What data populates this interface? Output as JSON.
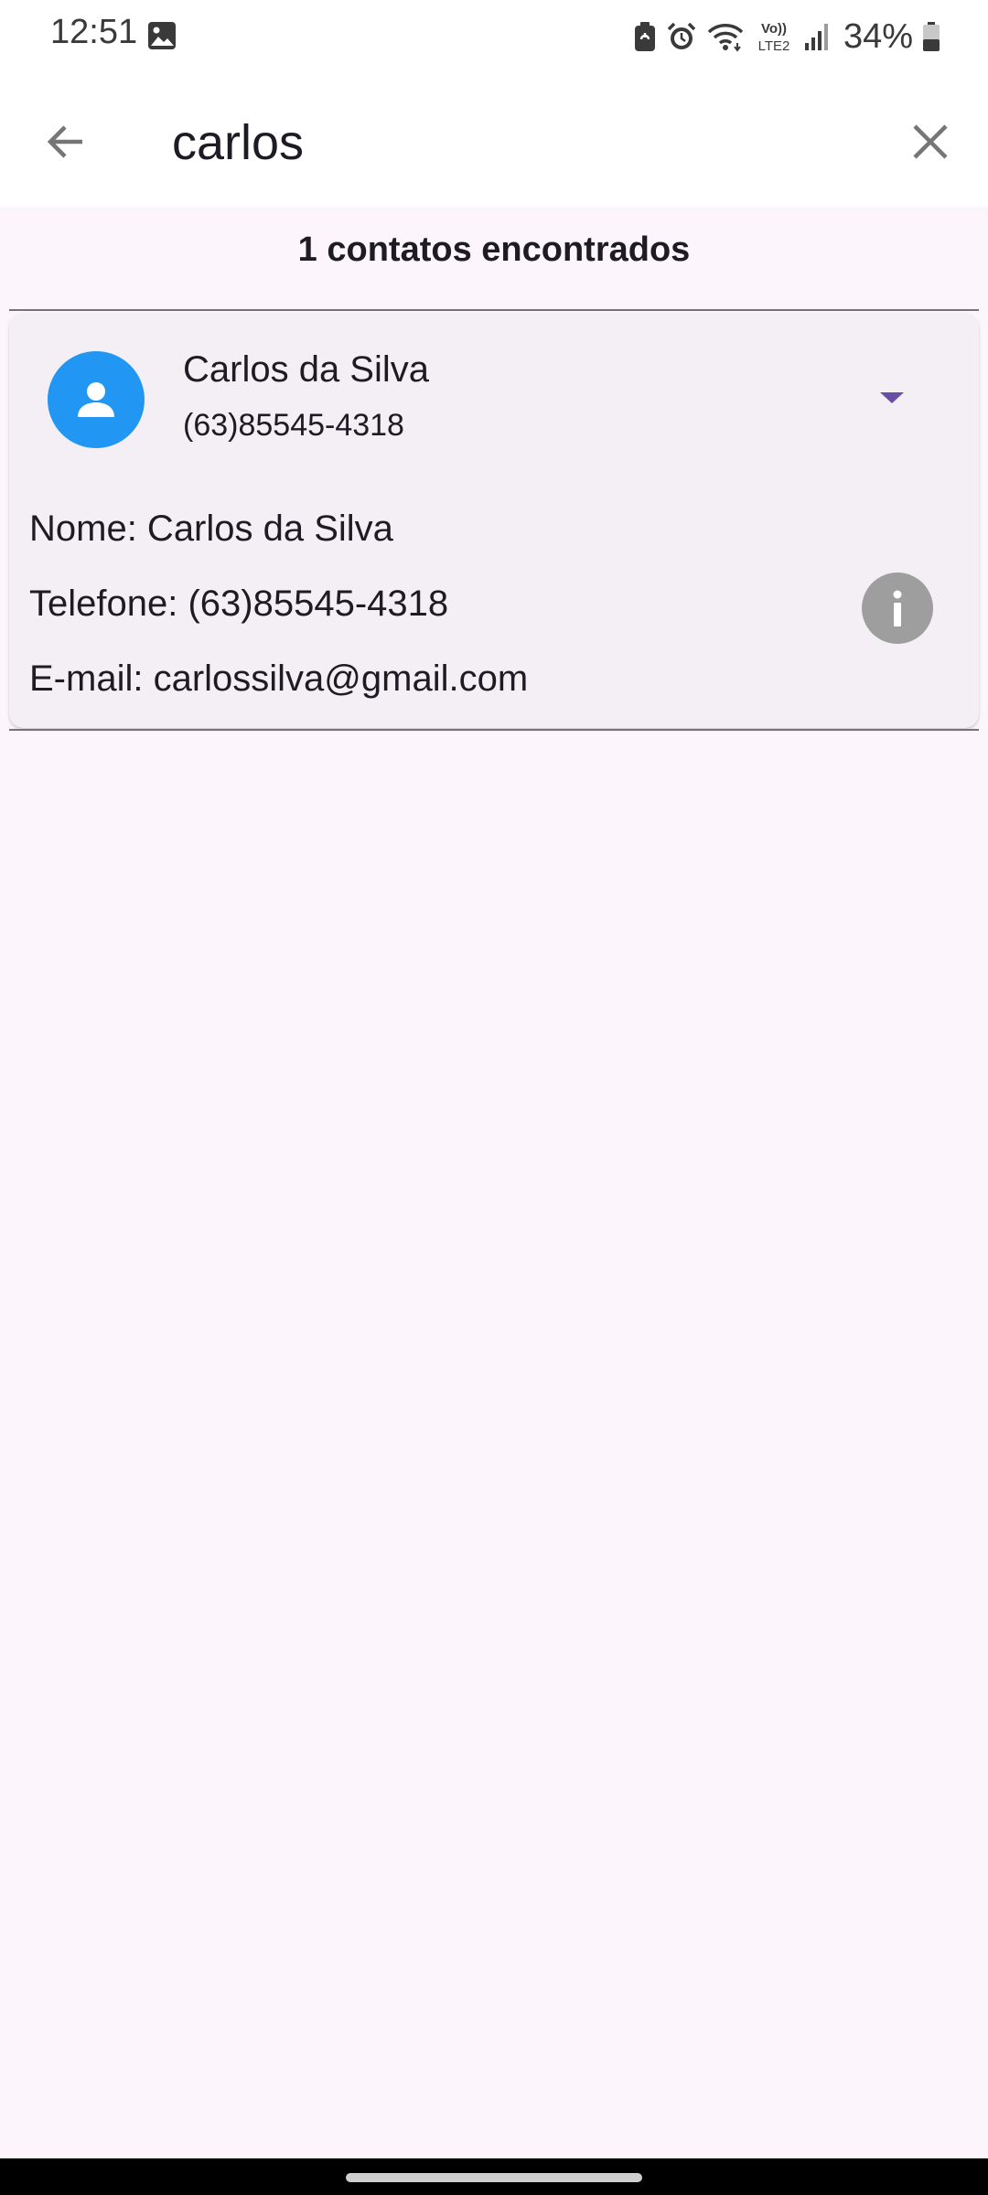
{
  "status_bar": {
    "time": "12:51",
    "battery": "34%",
    "icons": [
      "gallery-icon",
      "battery-saver-icon",
      "alarm-icon",
      "wifi-icon",
      "volte-icon",
      "signal-icon",
      "battery-icon"
    ],
    "volte_label_top": "Vo))",
    "volte_label_bottom": "LTE2"
  },
  "search": {
    "query": "carlos",
    "back_icon": "arrow-left-icon",
    "clear_icon": "close-icon"
  },
  "results": {
    "count_label": "1 contatos encontrados"
  },
  "contacts": [
    {
      "name": "Carlos da Silva",
      "phone": "(63)85545-4318",
      "avatar_icon": "person-icon",
      "avatar_color": "#2196f3",
      "expand_icon": "arrow-drop-down-icon",
      "details": {
        "name_line": "Nome: Carlos da Silva",
        "phone_line": "Telefone: (63)85545-4318",
        "email_line": "E-mail: carlossilva@gmail.com"
      },
      "info_icon": "info-icon"
    }
  ],
  "colors": {
    "background": "#fcf5fc",
    "card": "#f4eff5",
    "accent": "#6750a4",
    "info_button": "#9e9e9e"
  }
}
